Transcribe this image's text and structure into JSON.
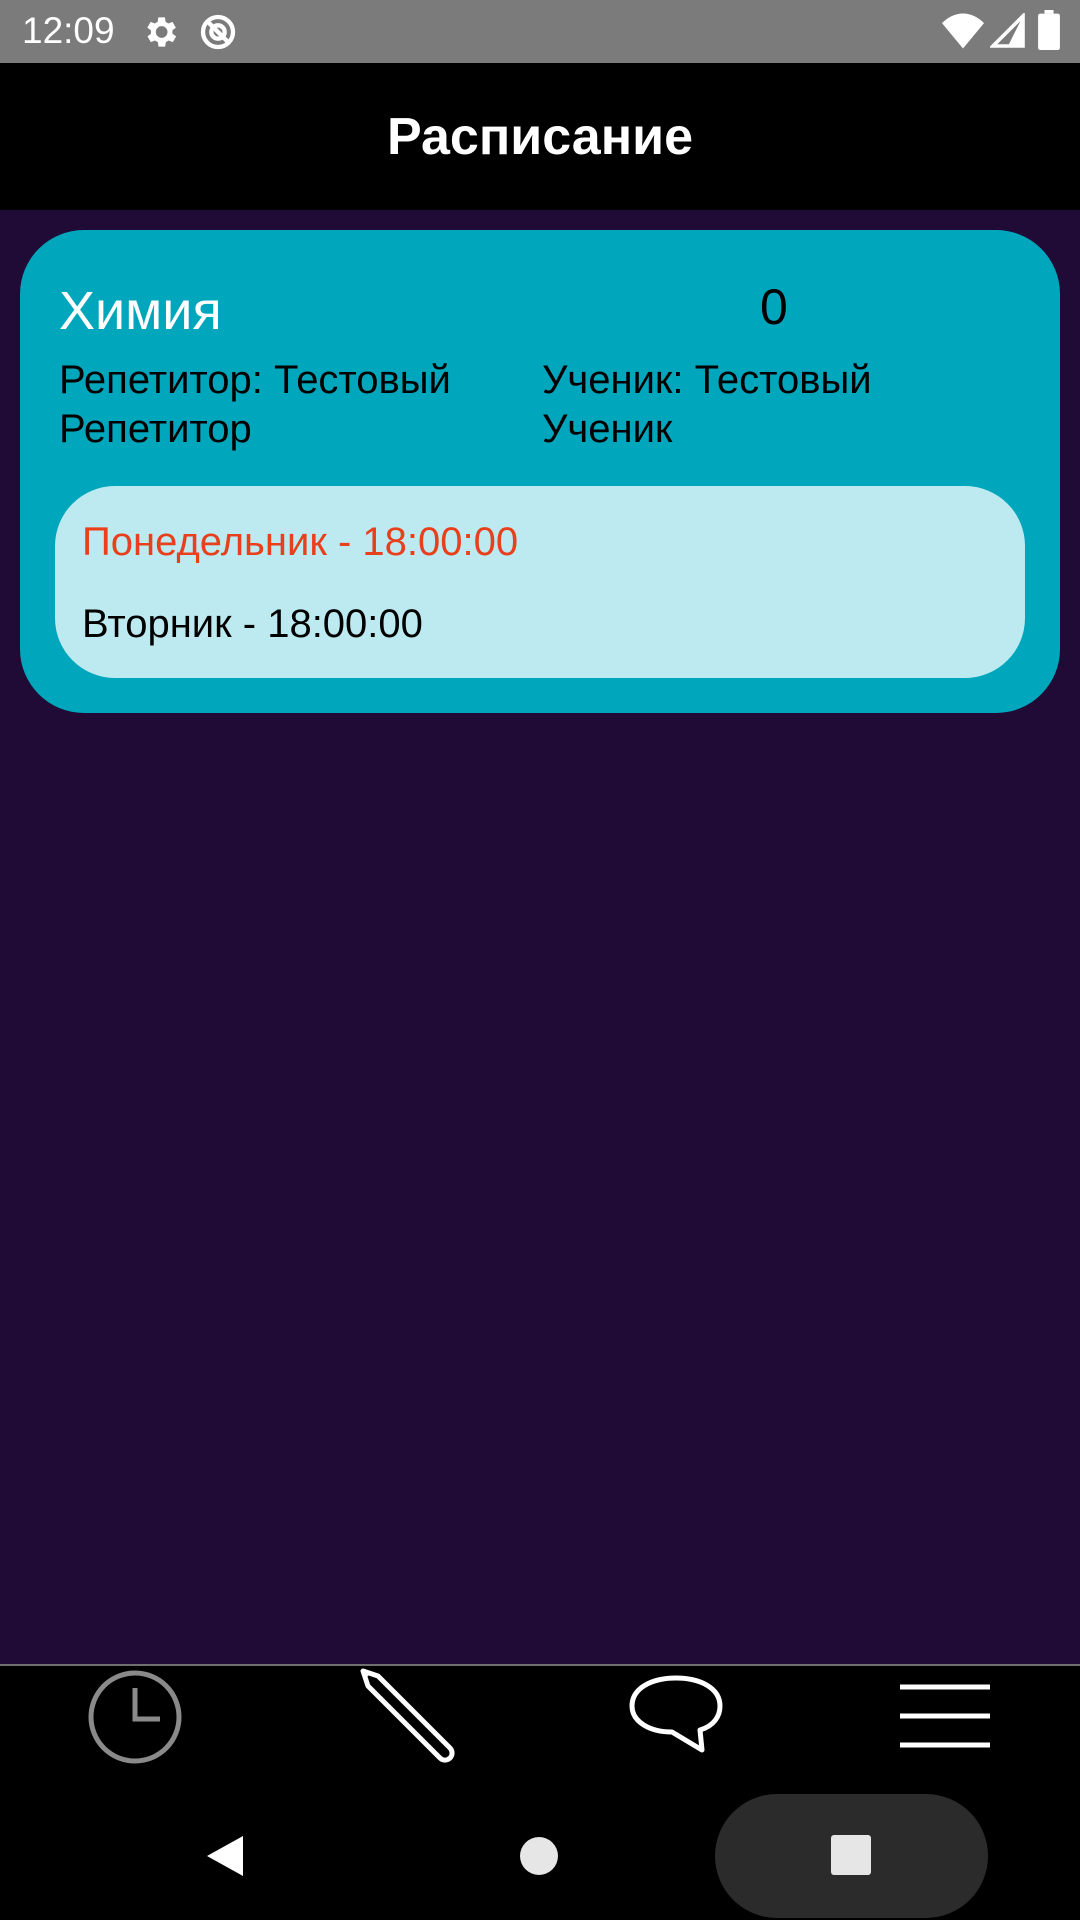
{
  "status_bar": {
    "time": "12:09",
    "icons": [
      "gear-icon",
      "sync-icon",
      "wifi-icon",
      "signal-icon",
      "battery-icon"
    ]
  },
  "header": {
    "title": "Расписание"
  },
  "lesson": {
    "subject": "Химия",
    "count": "0",
    "tutor": "Репетитор: Тестовый Репетитор",
    "student": "Ученик: Тестовый Ученик",
    "schedule": [
      {
        "text": "Понедельник - 18:00:00",
        "color": "#e8401c"
      },
      {
        "text": "Вторник - 18:00:00",
        "color": "#000000"
      }
    ]
  },
  "bottom_nav": {
    "items": [
      "clock-icon",
      "pencil-icon",
      "chat-icon",
      "menu-icon"
    ]
  },
  "colors": {
    "background": "#1f0b36",
    "card": "#00a6bb",
    "schedule_box": "#bdeaf0",
    "highlight": "#e8401c"
  }
}
